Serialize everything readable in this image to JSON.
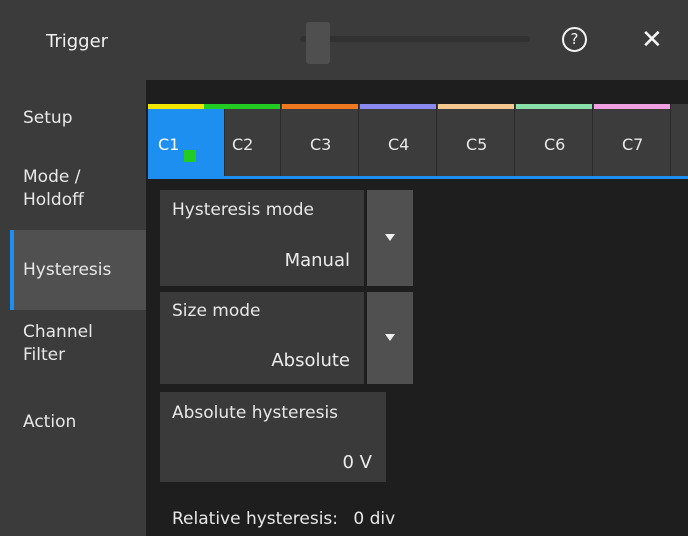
{
  "header": {
    "title": "Trigger",
    "help_glyph": "?",
    "close_glyph": "✕"
  },
  "sidebar": {
    "items": [
      {
        "label_lines": [
          "Setup"
        ]
      },
      {
        "label_lines": [
          "Mode /",
          "Holdoff"
        ]
      },
      {
        "label_lines": [
          "Hysteresis"
        ],
        "active": true
      },
      {
        "label_lines": [
          "Channel",
          "Filter"
        ]
      },
      {
        "label_lines": [
          "Action"
        ]
      }
    ]
  },
  "tabs": [
    {
      "label": "C1",
      "color": "#f2e600",
      "active": true
    },
    {
      "label": "C2",
      "color": "#22cc22"
    },
    {
      "label": "C3",
      "color": "#f07820"
    },
    {
      "label": "C4",
      "color": "#8a8af0"
    },
    {
      "label": "C5",
      "color": "#f5c890"
    },
    {
      "label": "C6",
      "color": "#88e0a8"
    },
    {
      "label": "C7",
      "color": "#f0a0e0"
    }
  ],
  "hysteresis_mode": {
    "label": "Hysteresis mode",
    "value": "Manual"
  },
  "size_mode": {
    "label": "Size mode",
    "value": "Absolute"
  },
  "absolute_hysteresis": {
    "label": "Absolute hysteresis",
    "value": "0 V"
  },
  "relative_hysteresis": {
    "label": "Relative hysteresis:",
    "value": "0 div"
  },
  "colors": {
    "accent": "#1d8ff0",
    "active_channel_indicator": "#22cc22"
  }
}
